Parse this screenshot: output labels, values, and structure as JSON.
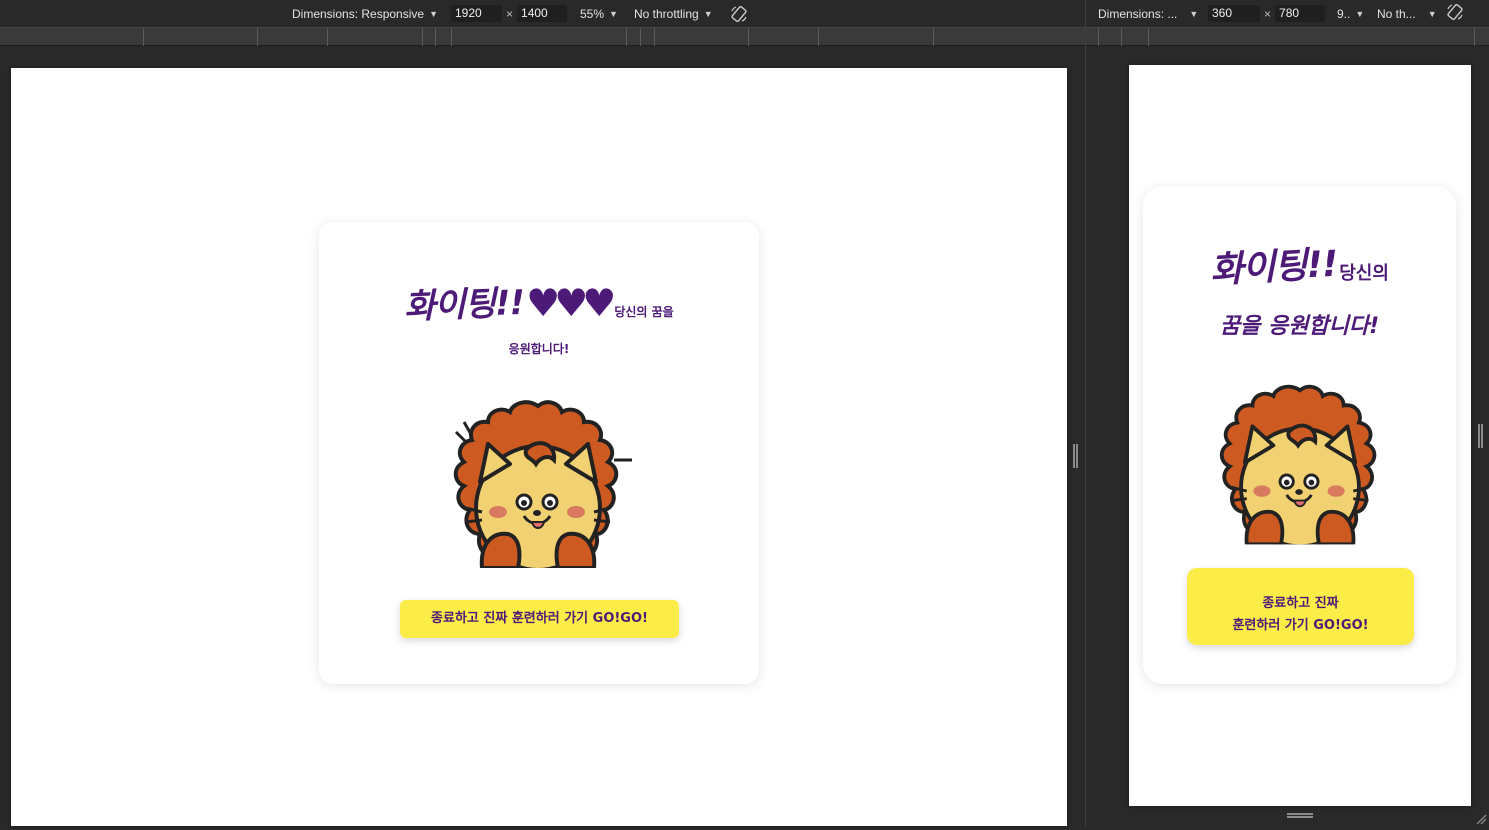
{
  "devtools_left": {
    "dimensions_label": "Dimensions: Responsive",
    "width": "1920",
    "height": "1400",
    "times": "×",
    "zoom": "55%",
    "throttling": "No throttling"
  },
  "devtools_right": {
    "dimensions_label": "Dimensions: ...",
    "width": "360",
    "height": "780",
    "times": "×",
    "zoom": "9..",
    "throttling": "No th..."
  },
  "page_desktop": {
    "headline_big": "화이팅!!",
    "headline_hearts": "♥♥♥",
    "headline_small": "당신의 꿈을",
    "headline_line2": "응원합니다!",
    "cta_label": "종료하고 진짜 훈련하러 가기 GO!GO!"
  },
  "page_mobile": {
    "headline_big": "화이팅!!",
    "headline_small": "당신의",
    "headline_line2": "꿈을 응원합니다!",
    "cta_line1": "종료하고 진짜",
    "cta_line2": "훈련하러 가기 GO!GO!"
  },
  "colors": {
    "accent_purple": "#4d1a78",
    "button_yellow": "#fbec47",
    "mane_orange": "#cc5a21",
    "face_yellow": "#f2d172"
  },
  "icons": {
    "caret": "▼",
    "rotate": "rotate-icon",
    "mascot": "lion-mascot"
  }
}
